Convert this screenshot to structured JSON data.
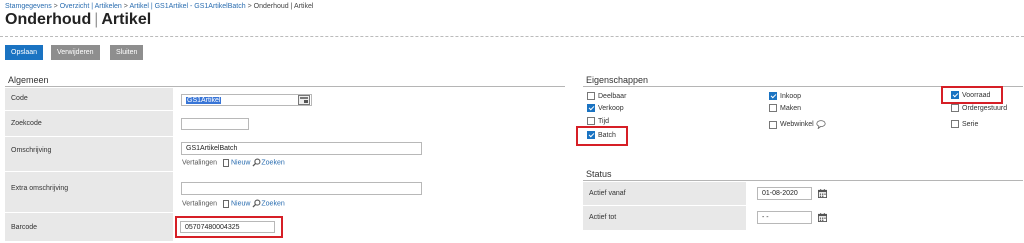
{
  "breadcrumb": {
    "items": [
      "Stamgegevens",
      "Overzicht | Artikelen",
      "Artikel | GS1Artikel - GS1ArtikelBatch"
    ],
    "current": "Onderhoud | Artikel",
    "separator": ">"
  },
  "title": {
    "part1": "Onderhoud",
    "part2": "Artikel"
  },
  "toolbar": {
    "save": "Opslaan",
    "delete": "Verwijderen",
    "close": "Sluiten"
  },
  "algemeen": {
    "heading": "Algemeen",
    "code_label": "Code",
    "code_value": "GS1Artikel",
    "zoekcode_label": "Zoekcode",
    "zoekcode_value": "",
    "omschrijving_label": "Omschrijving",
    "omschrijving_value": "GS1ArtikelBatch",
    "extra_label": "Extra omschrijving",
    "extra_value": "",
    "vertalingen": "Vertalingen",
    "nieuw": "Nieuw",
    "zoeken": "Zoeken",
    "barcode_label": "Barcode",
    "barcode_value": "05707480004325"
  },
  "eigenschappen": {
    "heading": "Eigenschappen",
    "items": [
      {
        "label": "Deelbaar",
        "checked": false
      },
      {
        "label": "Verkoop",
        "checked": true
      },
      {
        "label": "Tijd",
        "checked": false
      },
      {
        "label": "Batch",
        "checked": true
      },
      {
        "label": "Inkoop",
        "checked": true
      },
      {
        "label": "Maken",
        "checked": false
      },
      {
        "label": "Webwinkel",
        "checked": false
      },
      {
        "label": "Voorraad",
        "checked": true
      },
      {
        "label": "Ordergestuurd",
        "checked": false
      },
      {
        "label": "Serie",
        "checked": false
      }
    ]
  },
  "status": {
    "heading": "Status",
    "actief_vanaf_label": "Actief vanaf",
    "actief_vanaf_value": "01-08-2020",
    "actief_tot_label": "Actief tot",
    "actief_tot_value": "- -"
  },
  "colors": {
    "primary": "#1a73c2",
    "highlight": "#d61f26",
    "label_bg": "#e8e8e8"
  }
}
